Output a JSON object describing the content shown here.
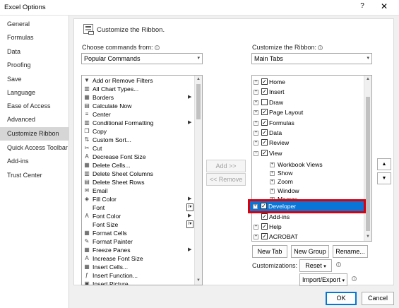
{
  "window": {
    "title": "Excel Options",
    "help": "?",
    "close": "✕"
  },
  "sidebar": {
    "items": [
      {
        "label": "General"
      },
      {
        "label": "Formulas"
      },
      {
        "label": "Data"
      },
      {
        "label": "Proofing"
      },
      {
        "label": "Save"
      },
      {
        "label": "Language"
      },
      {
        "label": "Ease of Access"
      },
      {
        "label": "Advanced"
      },
      {
        "label": "Customize Ribbon"
      },
      {
        "label": "Quick Access Toolbar"
      },
      {
        "label": "Add-ins"
      },
      {
        "label": "Trust Center"
      }
    ],
    "selected": "Customize Ribbon"
  },
  "header": {
    "title": "Customize the Ribbon."
  },
  "left": {
    "label": "Choose commands from:",
    "dropdown_value": "Popular Commands",
    "commands": [
      {
        "label": "Add or Remove Filters",
        "icon": "filter-icon",
        "glyph": "▼"
      },
      {
        "label": "All Chart Types...",
        "icon": "chart-icon",
        "glyph": "▥"
      },
      {
        "label": "Borders",
        "icon": "borders-icon",
        "glyph": "▦",
        "extra": "▶"
      },
      {
        "label": "Calculate Now",
        "icon": "calculator-icon",
        "glyph": "▤"
      },
      {
        "label": "Center",
        "icon": "center-align-icon",
        "glyph": "≡"
      },
      {
        "label": "Conditional Formatting",
        "icon": "conditional-formatting-icon",
        "glyph": "▥",
        "extra": "▶"
      },
      {
        "label": "Copy",
        "icon": "copy-icon",
        "glyph": "❐"
      },
      {
        "label": "Custom Sort...",
        "icon": "sort-icon",
        "glyph": "⇅"
      },
      {
        "label": "Cut",
        "icon": "cut-icon",
        "glyph": "✂"
      },
      {
        "label": "Decrease Font Size",
        "icon": "decrease-font-icon",
        "glyph": "A"
      },
      {
        "label": "Delete Cells...",
        "icon": "delete-cells-icon",
        "glyph": "▦"
      },
      {
        "label": "Delete Sheet Columns",
        "icon": "delete-columns-icon",
        "glyph": "▥"
      },
      {
        "label": "Delete Sheet Rows",
        "icon": "delete-rows-icon",
        "glyph": "▤"
      },
      {
        "label": "Email",
        "icon": "email-icon",
        "glyph": "✉"
      },
      {
        "label": "Fill Color",
        "icon": "fill-color-icon",
        "glyph": "◈",
        "extra": "▶"
      },
      {
        "label": "Font",
        "icon": "font-icon",
        "glyph": "",
        "box": "I▾"
      },
      {
        "label": "Font Color",
        "icon": "font-color-icon",
        "glyph": "A",
        "extra": "▶"
      },
      {
        "label": "Font Size",
        "icon": "font-size-icon",
        "glyph": "",
        "box": "I▾"
      },
      {
        "label": "Format Cells",
        "icon": "format-cells-icon",
        "glyph": "▦"
      },
      {
        "label": "Format Painter",
        "icon": "format-painter-icon",
        "glyph": "✎"
      },
      {
        "label": "Freeze Panes",
        "icon": "freeze-panes-icon",
        "glyph": "▦",
        "extra": "▶"
      },
      {
        "label": "Increase Font Size",
        "icon": "increase-font-icon",
        "glyph": "A"
      },
      {
        "label": "Insert Cells...",
        "icon": "insert-cells-icon",
        "glyph": "▦"
      },
      {
        "label": "Insert Function...",
        "icon": "insert-function-icon",
        "glyph": "ƒ"
      },
      {
        "label": "Insert Picture",
        "icon": "insert-picture-icon",
        "glyph": "▣"
      }
    ]
  },
  "middle": {
    "add": "Add >>",
    "remove": "<< Remove"
  },
  "right": {
    "label": "Customize the Ribbon:",
    "dropdown_value": "Main Tabs",
    "tabs": [
      {
        "label": "Home",
        "checked": true,
        "expander": "+"
      },
      {
        "label": "Insert",
        "checked": true,
        "expander": "+"
      },
      {
        "label": "Draw",
        "checked": false,
        "expander": "+"
      },
      {
        "label": "Page Layout",
        "checked": true,
        "expander": "+"
      },
      {
        "label": "Formulas",
        "checked": true,
        "expander": "+"
      },
      {
        "label": "Data",
        "checked": true,
        "expander": "+"
      },
      {
        "label": "Review",
        "checked": true,
        "expander": "+"
      },
      {
        "label": "View",
        "checked": true,
        "expander": "−"
      }
    ],
    "groups": [
      {
        "label": "Workbook Views"
      },
      {
        "label": "Show"
      },
      {
        "label": "Zoom"
      },
      {
        "label": "Window"
      },
      {
        "label": "Macros"
      }
    ],
    "developer": {
      "label": "Developer",
      "checked": true,
      "expander": "+"
    },
    "tabs_after": [
      {
        "label": "Add-ins",
        "checked": true,
        "expander": ""
      },
      {
        "label": "Help",
        "checked": true,
        "expander": "+"
      },
      {
        "label": "ACROBAT",
        "checked": true,
        "expander": "+"
      }
    ],
    "new_tab": "New Tab",
    "new_group": "New Group",
    "rename": "Rename...",
    "customizations_label": "Customizations:",
    "reset": "Reset",
    "import_export": "Import/Export"
  },
  "footer": {
    "ok": "OK",
    "cancel": "Cancel"
  },
  "colors": {
    "highlight_red": "#d9000d",
    "selection_blue": "#0a75d6",
    "sidebar_selected": "#d6d6d6"
  }
}
